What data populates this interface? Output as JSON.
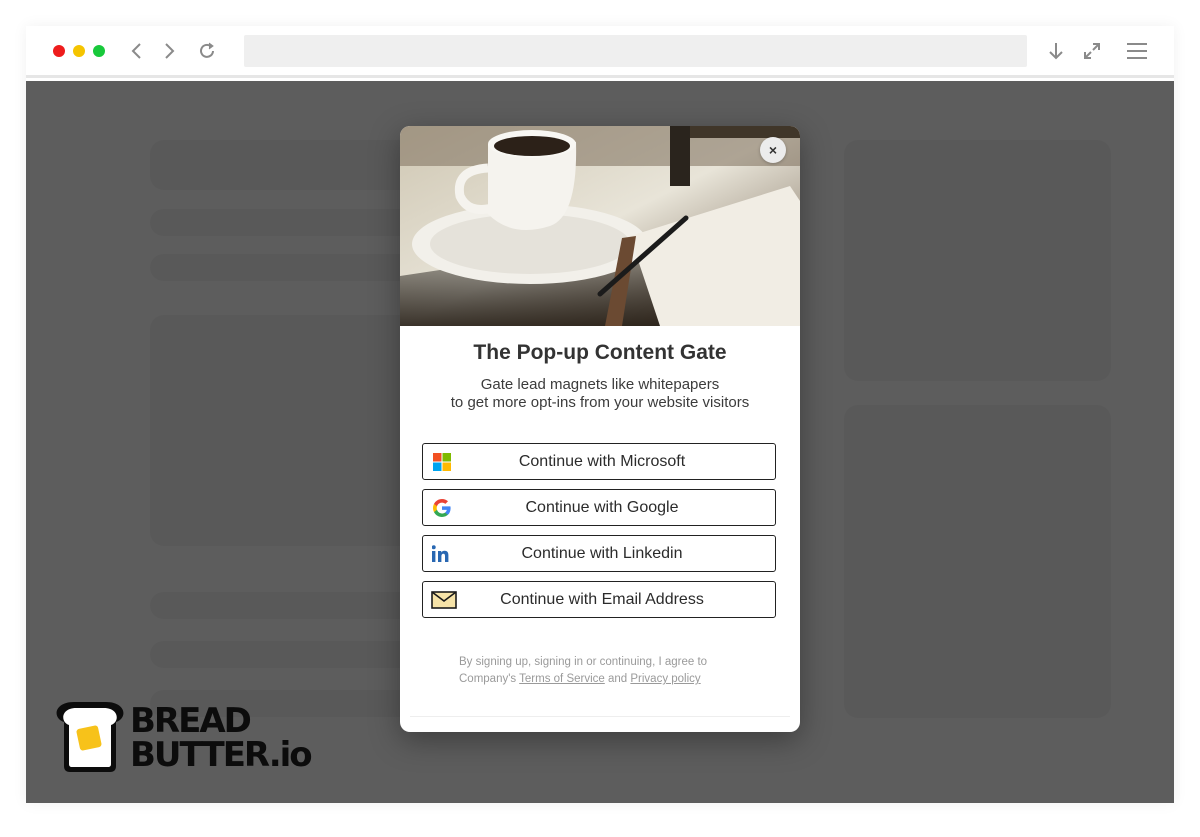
{
  "browser": {
    "icons": {
      "back": "chevron-left-icon",
      "forward": "chevron-right-icon",
      "reload": "reload-icon",
      "download": "download-arrow-icon",
      "fullscreen": "expand-icon",
      "menu": "hamburger-menu-icon"
    },
    "address_value": ""
  },
  "modal": {
    "close_label": "×",
    "title": "The Pop-up Content Gate",
    "subtitle_line1": "Gate lead magnets like whitepapers",
    "subtitle_line2": "to get more opt-ins from your website visitors",
    "buttons": [
      {
        "label": "Continue with Microsoft",
        "icon": "microsoft-logo-icon"
      },
      {
        "label": "Continue with Google",
        "icon": "google-logo-icon"
      },
      {
        "label": "Continue with Linkedin",
        "icon": "linkedin-logo-icon"
      },
      {
        "label": "Continue with Email Address",
        "icon": "envelope-icon"
      }
    ],
    "legal": {
      "line1": "By signing up, signing in or continuing, I agree to",
      "line2_prefix": "Company's ",
      "terms_link": "Terms of Service",
      "and_text": " and ",
      "privacy_link": "Privacy policy"
    }
  },
  "brand": {
    "line1": "BREAD",
    "line2": "BUTTER.io"
  },
  "colors": {
    "overlay": "#3c3c3c",
    "dot_red": "#ee1c1c",
    "dot_yellow": "#f5c400",
    "dot_green": "#18c93b",
    "linkedin_blue": "#2867b2",
    "butter_yellow": "#f7c21a"
  }
}
